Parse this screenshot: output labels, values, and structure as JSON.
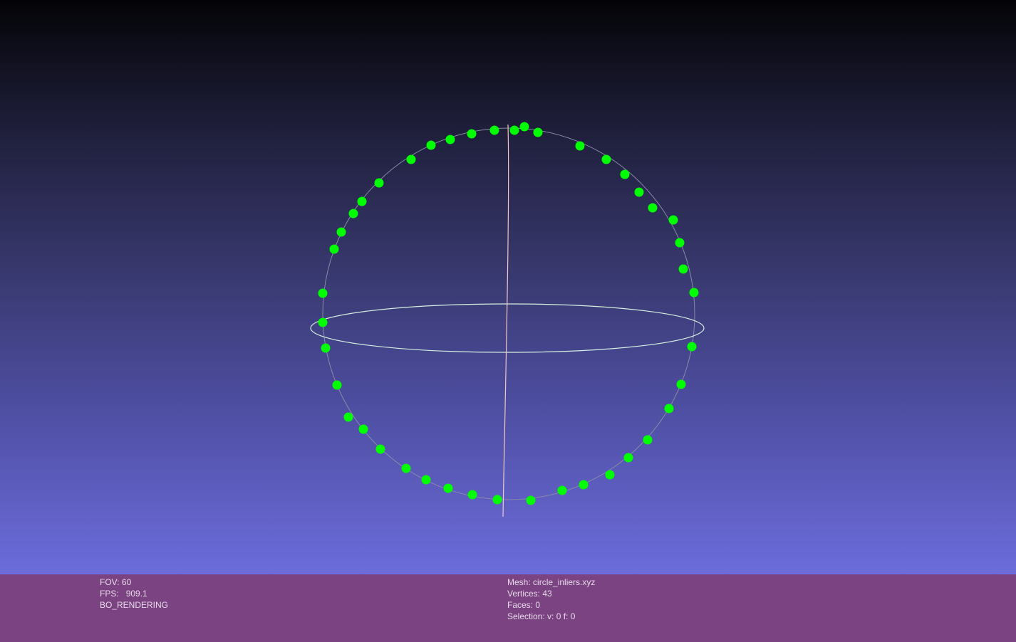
{
  "info": {
    "fov_label": "FOV:",
    "fov_value": "60",
    "fps_label": "FPS:",
    "fps_value": "909.1",
    "render_mode": "BO_RENDERING",
    "mesh_label": "Mesh:",
    "mesh_value": "circle_inliers.xyz",
    "vertices_label": "Vertices:",
    "vertices_value": "43",
    "faces_label": "Faces:",
    "faces_value": "0",
    "selection_label": "Selection:",
    "selection_value": "v: 0 f: 0"
  },
  "colors": {
    "points": "#00ff00",
    "trackball_horizontal": "#d6f0e0",
    "trackball_vertical": "#f2c8c8",
    "trackball_outline": "#8a8aa8",
    "infobar_bg": "#7b4382"
  },
  "scene": {
    "point_count": 43
  }
}
